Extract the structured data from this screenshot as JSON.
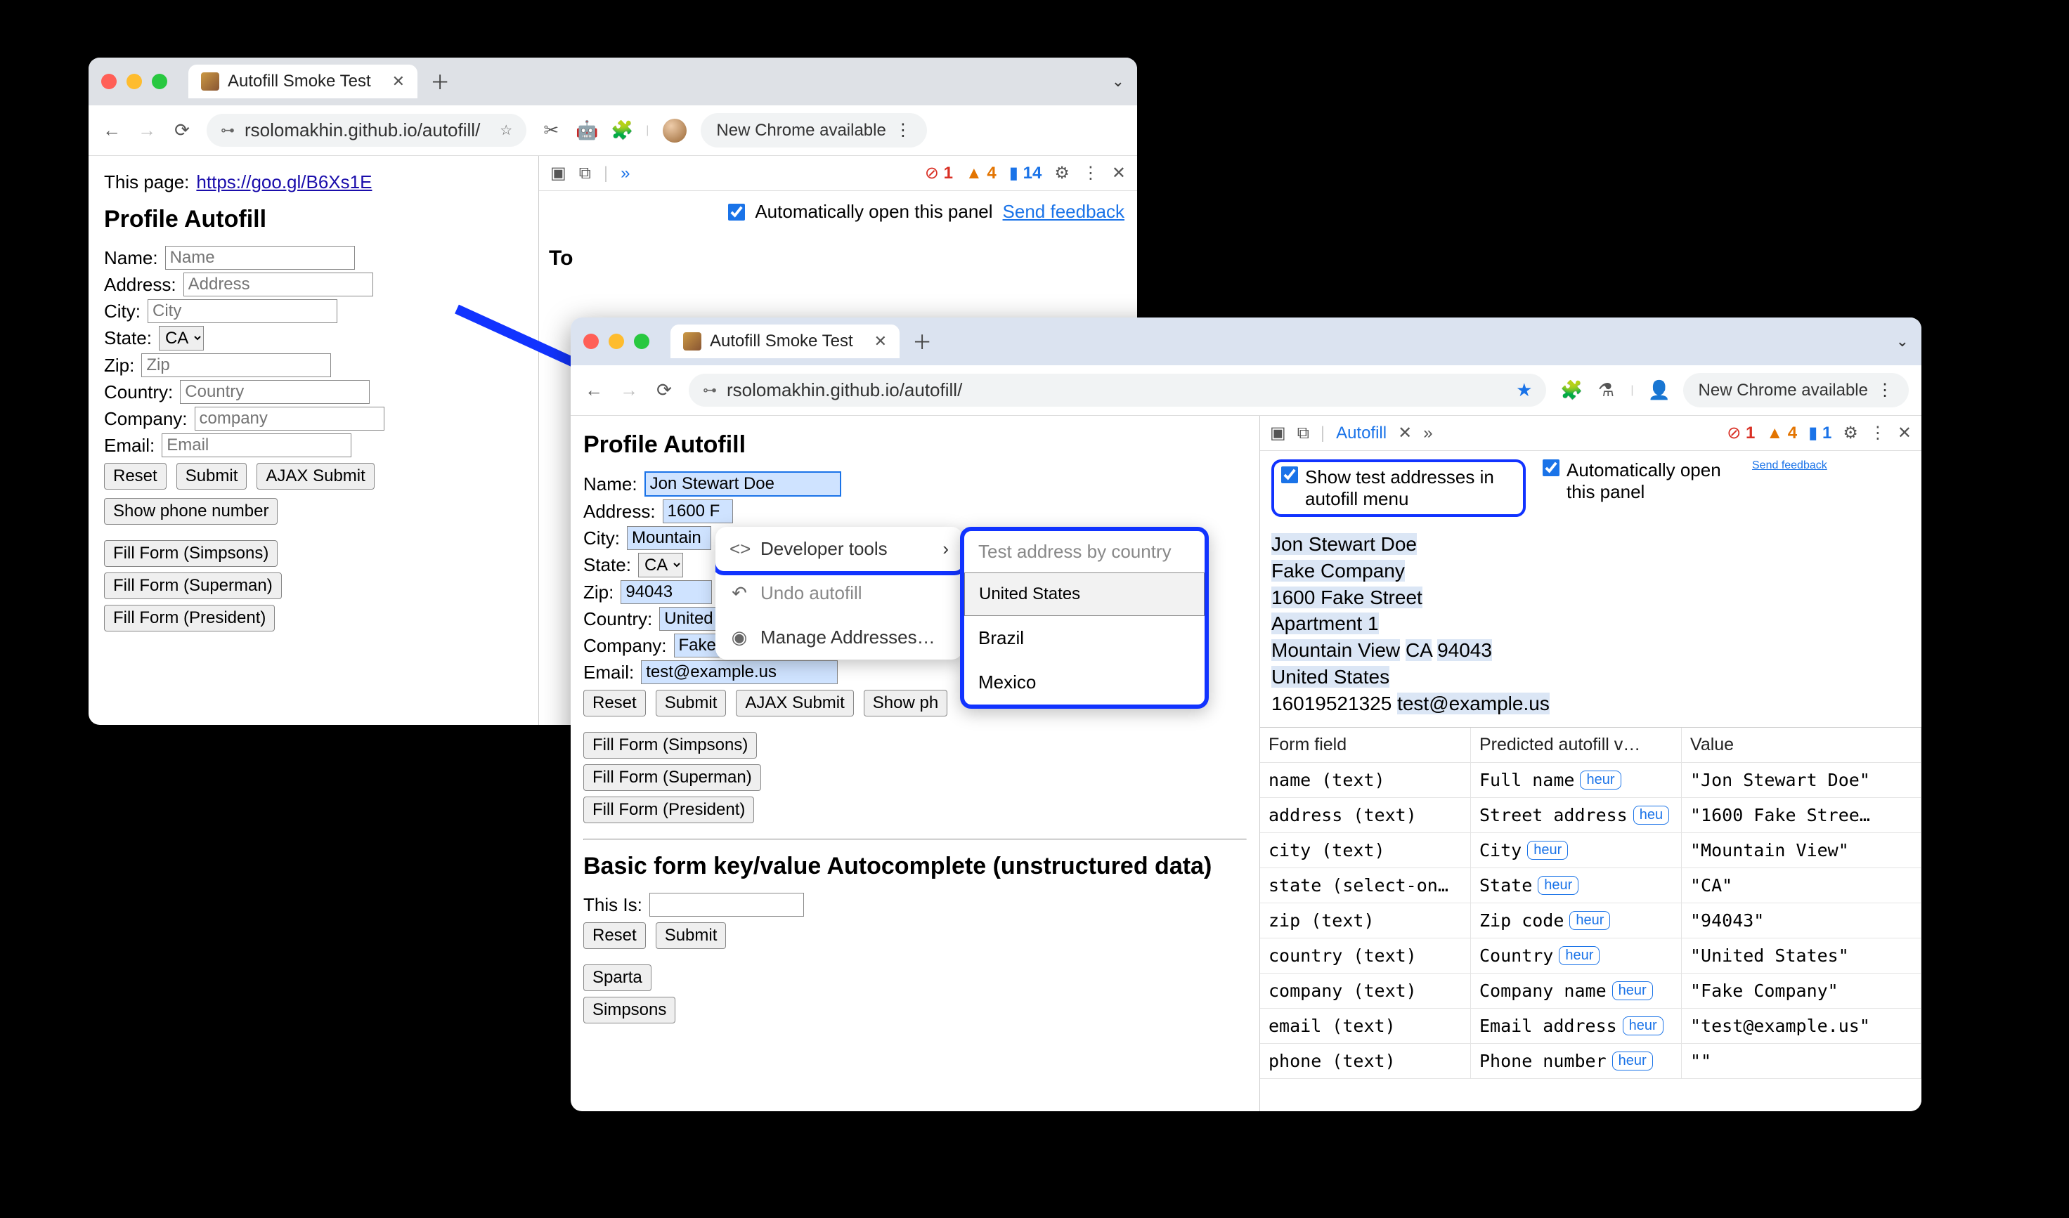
{
  "winA": {
    "tab_title": "Autofill Smoke Test",
    "url": "rsolomakhin.github.io/autofill/",
    "new_chrome": "New Chrome available",
    "page_label": "This page:",
    "page_link": "https://goo.gl/B6Xs1E",
    "h_profile": "Profile Autofill",
    "labels": {
      "name": "Name:",
      "address": "Address:",
      "city": "City:",
      "state": "State:",
      "zip": "Zip:",
      "country": "Country:",
      "company": "Company:",
      "email": "Email:"
    },
    "ph": {
      "name": "Name",
      "address": "Address",
      "city": "City",
      "zip": "Zip",
      "country": "Country",
      "company": "company",
      "email": "Email"
    },
    "state_value": "CA",
    "buttons": {
      "reset": "Reset",
      "submit": "Submit",
      "ajax": "AJAX Submit",
      "showphone": "Show phone number",
      "simpsons": "Fill Form (Simpsons)",
      "superman": "Fill Form (Superman)",
      "president": "Fill Form (President)"
    },
    "devtools": {
      "err": "1",
      "warn": "4",
      "info": "14",
      "auto_open": "Automatically open this panel",
      "feedback": "Send feedback",
      "cut_text": "To"
    }
  },
  "winB": {
    "tab_title": "Autofill Smoke Test",
    "url": "rsolomakhin.github.io/autofill/",
    "new_chrome": "New Chrome available",
    "h_profile": "Profile Autofill",
    "labels": {
      "name": "Name:",
      "address": "Address:",
      "city": "City:",
      "state": "State:",
      "zip": "Zip:",
      "country": "Country:",
      "company": "Company:",
      "email": "Email:",
      "thisis": "This Is:"
    },
    "values": {
      "name": "Jon Stewart Doe",
      "address": "1600 F",
      "city": "Mountain",
      "state": "CA",
      "zip": "94043",
      "country": "United",
      "company": "Fake",
      "email": "test@example.us"
    },
    "buttons": {
      "reset": "Reset",
      "submit": "Submit",
      "ajax": "AJAX Submit",
      "showp": "Show ph",
      "simpsons": "Fill Form (Simpsons)",
      "superman": "Fill Form (Superman)",
      "president": "Fill Form (President)",
      "sparta": "Sparta",
      "simpsons2": "Simpsons"
    },
    "h_basic": "Basic form key/value Autocomplete (unstructured data)",
    "ctxA": {
      "dev": "Developer tools",
      "undo": "Undo autofill",
      "manage": "Manage Addresses…"
    },
    "ctxB": {
      "hdr": "Test address by country",
      "us": "United States",
      "br": "Brazil",
      "mx": "Mexico"
    },
    "dev": {
      "tab": "Autofill",
      "err": "1",
      "warn": "4",
      "info": "1",
      "opt_test": "Show test addresses in autofill menu",
      "opt_auto": "Automatically open this panel",
      "feedback": "Send feedback",
      "card": {
        "l1": "Jon Stewart Doe",
        "l2": "Fake Company",
        "l3": "1600 Fake Street",
        "l4": "Apartment 1",
        "l5a": "Mountain View",
        "l5b": "CA",
        "l5c": "94043",
        "l6": "United States",
        "l7a": "16019521325",
        "l7b": "test@example.us"
      },
      "cols": {
        "c1": "Form field",
        "c2": "Predicted autofill v…",
        "c3": "Value"
      },
      "rows": [
        {
          "f": "name (text)",
          "p": "Full name",
          "h": "heur",
          "v": "\"Jon Stewart Doe\""
        },
        {
          "f": "address (text)",
          "p": "Street address",
          "h": "heu",
          "v": "\"1600 Fake Stree…"
        },
        {
          "f": "city (text)",
          "p": "City",
          "h": "heur",
          "v": "\"Mountain View\""
        },
        {
          "f": "state (select-on…",
          "p": "State",
          "h": "heur",
          "v": "\"CA\""
        },
        {
          "f": "zip (text)",
          "p": "Zip code",
          "h": "heur",
          "v": "\"94043\""
        },
        {
          "f": "country (text)",
          "p": "Country",
          "h": "heur",
          "v": "\"United States\""
        },
        {
          "f": "company (text)",
          "p": "Company name",
          "h": "heur",
          "v": "\"Fake Company\""
        },
        {
          "f": "email (text)",
          "p": "Email address",
          "h": "heur",
          "v": "\"test@example.us\""
        },
        {
          "f": "phone (text)",
          "p": "Phone number",
          "h": "heur",
          "v": "\"\""
        }
      ]
    }
  }
}
